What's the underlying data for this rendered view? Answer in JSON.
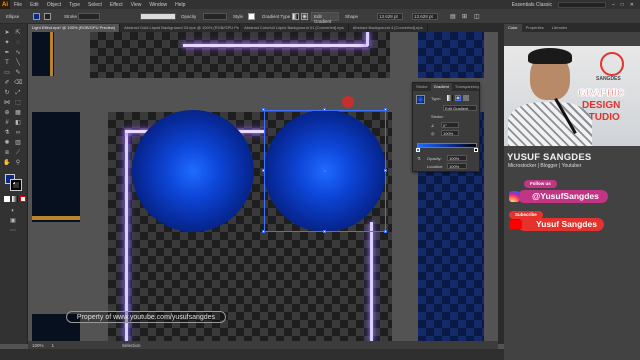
{
  "app": {
    "logo": "Ai"
  },
  "menubar": {
    "items": [
      "File",
      "Edit",
      "Object",
      "Type",
      "Select",
      "Effect",
      "View",
      "Window",
      "Help"
    ],
    "workspace": "Essentials Classic"
  },
  "control_bar": {
    "object_type": "Ellipse",
    "stroke_label": "Stroke",
    "opacity_label": "Opacity",
    "style_label": "Style",
    "gradient_type_label": "Gradient Type",
    "edit_gradient": "Edit Gradient",
    "shape_label": "Shape",
    "width": "13.628 pt",
    "height": "13.628 pt"
  },
  "tabs": [
    {
      "label": "Light Effect.eps* @ 100% (RGB/GPU Preview)",
      "active": true
    },
    {
      "label": "Abstract Gold Liquid Background 03.eps @ 100% (RGB/GPU Preview)",
      "active": false
    },
    {
      "label": "Abstract Colorfull Liquid Background 01 [Converted].eps",
      "active": false
    },
    {
      "label": "Abstract Background 4 [Converted].eps",
      "active": false
    }
  ],
  "gradient_panel": {
    "tabs": [
      "Stroke",
      "Gradient",
      "Transparency"
    ],
    "active_tab": "Gradient",
    "type_label": "Type:",
    "stroke_label": "Stroke:",
    "angle_value": "0°",
    "aspect_value": "100%",
    "opacity_label": "Opacity:",
    "opacity_value": "100%",
    "location_label": "Location:",
    "location_value": "100%",
    "edit_label": "Edit Gradient"
  },
  "status": {
    "zoom": "100%",
    "page": "1",
    "tool": "Selection"
  },
  "right_panel": {
    "tabs": [
      "Color",
      "Properties",
      "Libraries"
    ],
    "active_tab": "Color"
  },
  "overlay": {
    "brand_top": "SANGDES",
    "brand_lines": [
      "GRAPHIC",
      "DESIGN",
      "STUDIO"
    ],
    "name": "YUSUF SANGDES",
    "subtitle": "Microstocker | Blogger | Youtuber",
    "follow_label": "Follow us",
    "instagram_handle": "@YusufSangdes",
    "subscribe_label": "Subscribe",
    "youtube_name": "Yusuf Sangdes",
    "watermark": "Property of www.youtube.com/yusufsangdes"
  },
  "colors": {
    "accent": "#e5322d",
    "sphere_center": "#1f6bff",
    "sphere_edge": "#031347",
    "neon": "#9d7bff"
  }
}
